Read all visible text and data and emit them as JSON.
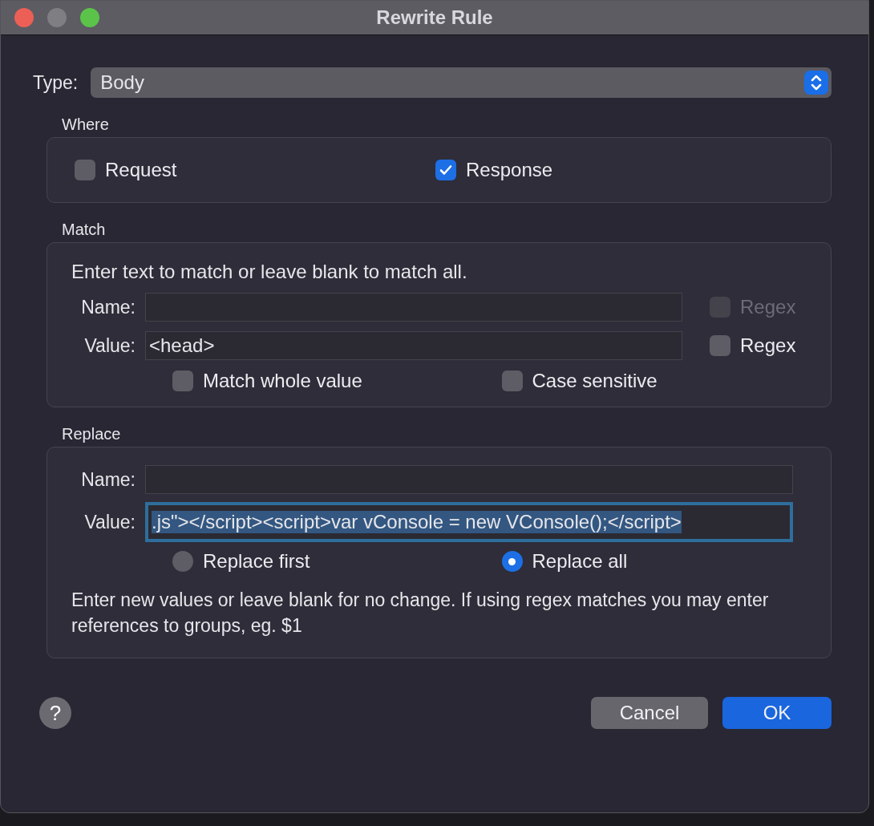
{
  "window": {
    "title": "Rewrite Rule"
  },
  "type": {
    "label": "Type:",
    "value": "Body"
  },
  "where": {
    "title": "Where",
    "options": [
      {
        "label": "Request",
        "checked": false
      },
      {
        "label": "Response",
        "checked": true
      }
    ]
  },
  "match": {
    "title": "Match",
    "hint": "Enter text to match or leave blank to match all.",
    "fields": [
      {
        "label": "Name:",
        "regex": {
          "label": "Regex",
          "checked": false,
          "disabled": true
        }
      },
      {
        "label": "Value:",
        "value": "<head>",
        "regex": {
          "label": "Regex",
          "checked": false,
          "disabled": false
        }
      }
    ],
    "options": [
      {
        "label": "Match whole value",
        "checked": false
      },
      {
        "label": "Case sensitive",
        "checked": false
      }
    ]
  },
  "replace": {
    "title": "Replace",
    "fields": [
      {
        "label": "Name:",
        "focused": false
      },
      {
        "label": "Value:",
        "value": ".js\"></script><script>var vConsole = new VConsole();</script>",
        "focused": true
      }
    ],
    "modes": [
      {
        "label": "Replace first",
        "selected": false
      },
      {
        "label": "Replace all",
        "selected": true
      }
    ],
    "hint": "Enter new values or leave blank for no change. If using regex matches you may enter references to groups, eg. $1"
  },
  "help": "?",
  "buttons": [
    {
      "label": "Cancel",
      "kind": "secondary"
    },
    {
      "label": "OK",
      "kind": "primary"
    }
  ]
}
